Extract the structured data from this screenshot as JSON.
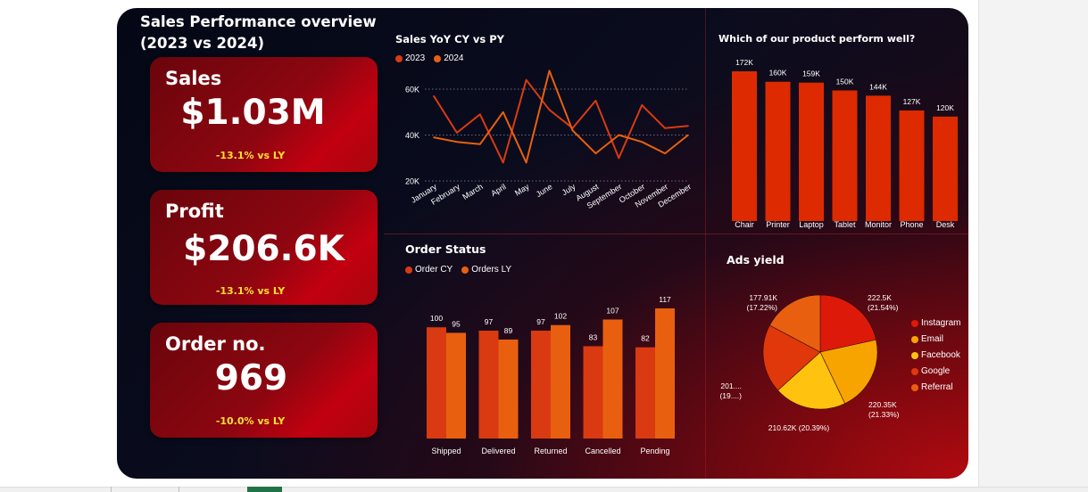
{
  "page": {
    "title_line1": "Sales Performance overview",
    "title_line2": "(2023 vs 2024)"
  },
  "kpis": {
    "sales": {
      "label": "Sales",
      "value": "$1.03M",
      "delta": "-13.1% vs LY"
    },
    "profit": {
      "label": "Profit",
      "value": "$206.6K",
      "delta": "-13.1% vs LY"
    },
    "orders": {
      "label": "Order no.",
      "value": "969",
      "delta": "-10.0% vs LY"
    }
  },
  "colors": {
    "series_a": "#d93a12",
    "series_b": "#e8600f",
    "bar": "#dd2a00",
    "delta_text": "#ffe033",
    "instagram": "#dd1a0a",
    "email": "#f7a400",
    "facebook": "#ffc20e",
    "google": "#e0380a",
    "referral": "#e8600f"
  },
  "chart_data": [
    {
      "type": "line",
      "title": "Sales YoY CY vs PY",
      "x": [
        "January",
        "February",
        "March",
        "April",
        "May",
        "June",
        "July",
        "August",
        "September",
        "October",
        "November",
        "December"
      ],
      "series": [
        {
          "name": "2023",
          "values": [
            57000,
            41000,
            49000,
            28000,
            64000,
            51000,
            43000,
            55000,
            30000,
            53000,
            43000,
            44000
          ]
        },
        {
          "name": "2024",
          "values": [
            39000,
            37000,
            36000,
            50000,
            28000,
            68000,
            42000,
            32000,
            40000,
            37000,
            32000,
            40000
          ]
        }
      ],
      "yticks": [
        "20K",
        "40K",
        "60K"
      ],
      "ylim": [
        20000,
        60000
      ],
      "grid": true,
      "legend": "top-left"
    },
    {
      "type": "bar",
      "title": "Which of our product perform well?",
      "categories": [
        "Chair",
        "Printer",
        "Laptop",
        "Tablet",
        "Monitor",
        "Phone",
        "Desk"
      ],
      "values": [
        172000,
        160000,
        159000,
        150000,
        144000,
        127000,
        120000
      ],
      "data_labels": [
        "172K",
        "160K",
        "159K",
        "150K",
        "144K",
        "127K",
        "120K"
      ],
      "ylim": [
        0,
        172000
      ],
      "grid": false
    },
    {
      "type": "bar",
      "title": "Order Status",
      "categories": [
        "Shipped",
        "Delivered",
        "Returned",
        "Cancelled",
        "Pending"
      ],
      "series": [
        {
          "name": "Order CY",
          "values": [
            100,
            97,
            97,
            83,
            82
          ]
        },
        {
          "name": "Orders LY",
          "values": [
            95,
            89,
            102,
            107,
            117
          ]
        }
      ],
      "ylim": [
        0,
        117
      ],
      "legend": "top-left",
      "grid": false
    },
    {
      "type": "pie",
      "title": "Ads yield",
      "labels": [
        "Instagram",
        "Email",
        "Facebook",
        "Google",
        "Referral"
      ],
      "values": [
        222500,
        220350,
        210620,
        201000,
        177910
      ],
      "data_labels": [
        "222.5K (21.54%)",
        "220.35K (21.33%)",
        "210.62K (20.39%)",
        "201.... (19....)",
        "177.91K (17.22%)"
      ],
      "data_label_lines": [
        [
          "222.5K",
          "(21.54%)"
        ],
        [
          "220.35K",
          "(21.33%)"
        ],
        [
          "210.62K (20.39%)"
        ],
        [
          "201....",
          "(19....)"
        ],
        [
          "177.91K",
          "(17.22%)"
        ]
      ],
      "legend": "right"
    }
  ]
}
